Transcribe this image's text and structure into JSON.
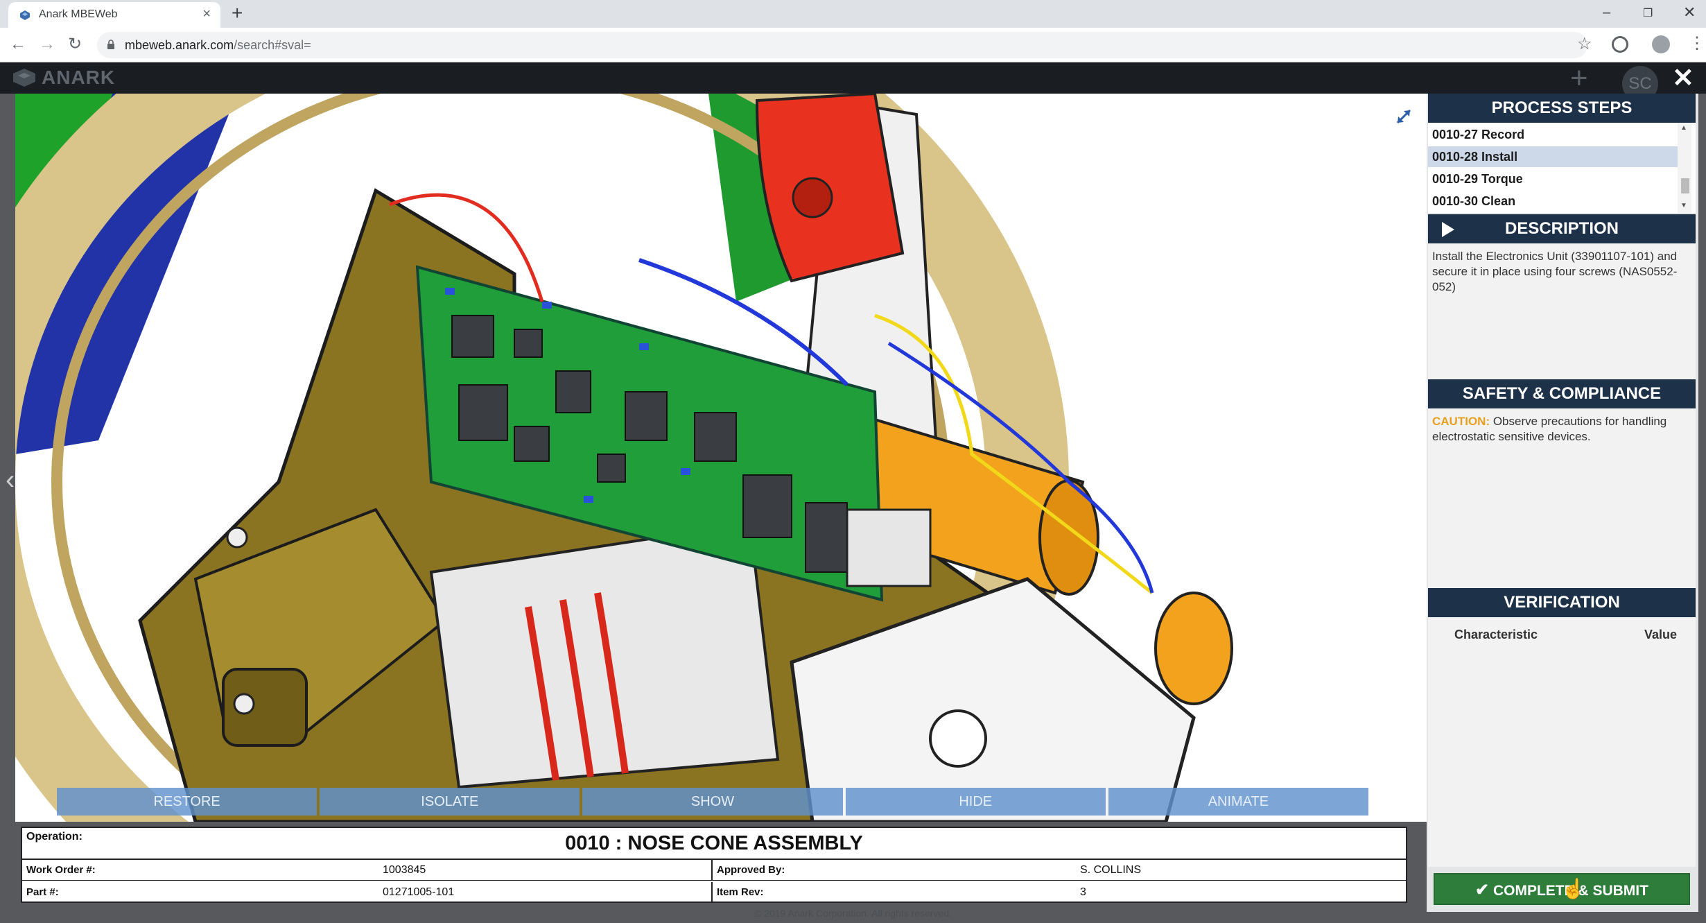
{
  "browser": {
    "tab_title": "Anark MBEWeb",
    "url_host": "mbeweb.anark.com",
    "url_path": "/search#sval="
  },
  "app": {
    "logo_text": "ANARK",
    "avatar_initials": "SC"
  },
  "toolbar": {
    "buttons": [
      "RESTORE",
      "ISOLATE",
      "SHOW",
      "HIDE",
      "ANIMATE"
    ]
  },
  "operation": {
    "label": "Operation:",
    "title": "0010 :  NOSE CONE ASSEMBLY",
    "work_order_label": "Work Order #:",
    "work_order_value": "1003845",
    "approved_by_label": "Approved By:",
    "approved_by_value": "S. COLLINS",
    "part_label": "Part #:",
    "part_value": "01271005-101",
    "item_rev_label": "Item Rev:",
    "item_rev_value": "3"
  },
  "footer": "© 2019 Anark Corporation. All rights reserved.",
  "panel": {
    "process_steps_title": "PROCESS STEPS",
    "steps": [
      {
        "label": "0010-27 Record",
        "selected": false
      },
      {
        "label": "0010-28 Install",
        "selected": true
      },
      {
        "label": "0010-29 Torque",
        "selected": false
      },
      {
        "label": "0010-30 Clean",
        "selected": false
      }
    ],
    "description_title": "DESCRIPTION",
    "description_text": "Install the Electronics Unit (33901107-101) and secure it in place using four screws (NAS0552-052)",
    "safety_title": "SAFETY & COMPLIANCE",
    "caution_label": "CAUTION:",
    "caution_text": " Observe precautions for handling electrostatic sensitive devices.",
    "verification_title": "VERIFICATION",
    "verification_columns": [
      "Characteristic",
      "Value"
    ],
    "submit_label": "COMPLETE & SUBMIT"
  },
  "colors": {
    "panel_header": "#1d3148",
    "toolbar_button": "#6091cd",
    "submit_button": "#2e7d3b",
    "caution": "#e8a020"
  },
  "icons": [
    "anark-favicon",
    "lock-icon",
    "star-icon",
    "expand-icon",
    "play-icon",
    "check-icon",
    "close-icon",
    "plus-icon"
  ]
}
